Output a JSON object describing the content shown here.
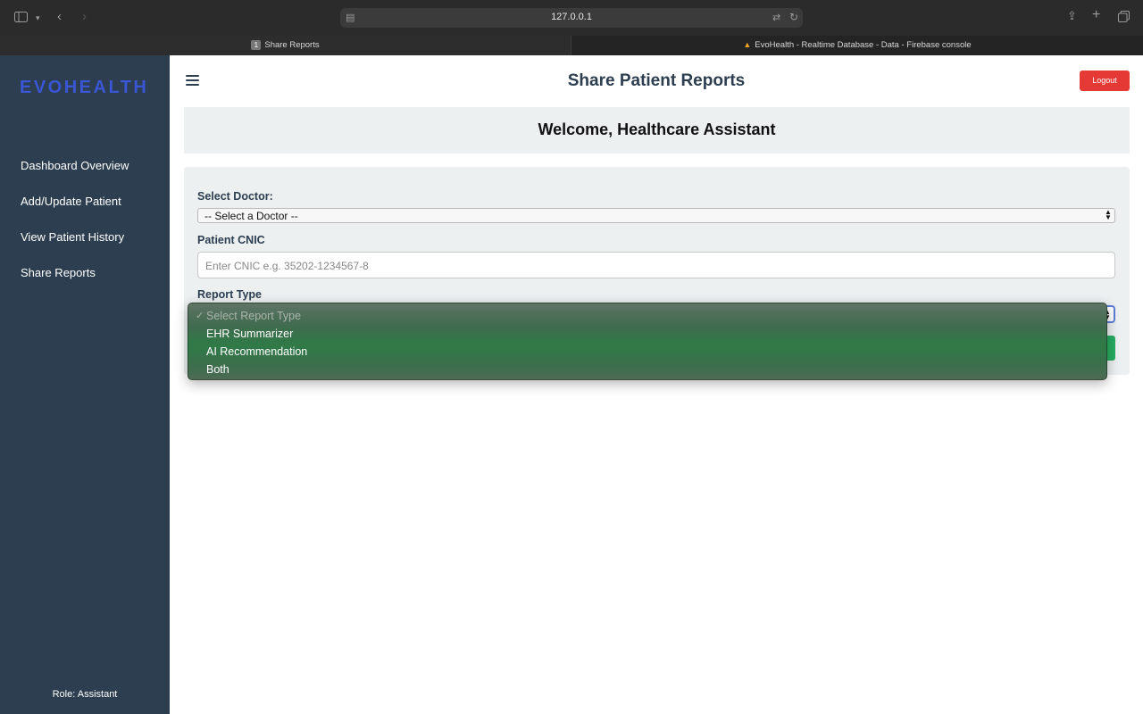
{
  "browser": {
    "url": "127.0.0.1",
    "tabs": [
      {
        "badge": "1",
        "label": "Share Reports"
      },
      {
        "label": "EvoHealth - Realtime Database - Data - Firebase console"
      }
    ]
  },
  "sidebar": {
    "logo": "EVOHEALTH",
    "items": [
      {
        "label": "Dashboard Overview"
      },
      {
        "label": "Add/Update Patient"
      },
      {
        "label": "View Patient History"
      },
      {
        "label": "Share Reports"
      }
    ],
    "role": "Role: Assistant"
  },
  "header": {
    "title": "Share Patient Reports",
    "logout_label": "Logout"
  },
  "welcome": "Welcome, Healthcare Assistant",
  "form": {
    "doctor_label": "Select Doctor:",
    "doctor_value": "-- Select a Doctor --",
    "cnic_label": "Patient CNIC",
    "cnic_placeholder": "Enter CNIC e.g. 35202-1234567-8",
    "report_label": "Report Type",
    "report_options": [
      {
        "label": "Select Report Type",
        "selected": true,
        "disabled": true
      },
      {
        "label": "EHR Summarizer"
      },
      {
        "label": "AI Recommendation"
      },
      {
        "label": "Both"
      }
    ]
  },
  "colors": {
    "sidebar": "#2c3e50",
    "logo": "#3a56d4",
    "logout": "#e53935",
    "submit": "#27ae60",
    "panel": "#ecf0f1"
  },
  "icons": [
    "sidebar-toggle-icon",
    "chevron-down-icon",
    "back-icon",
    "forward-icon",
    "page-icon",
    "translate-icon",
    "reload-icon",
    "share-icon",
    "new-tab-icon",
    "tabs-overview-icon",
    "hamburger-icon",
    "updown-arrows-icon",
    "checkmark-icon",
    "firebase-icon"
  ]
}
